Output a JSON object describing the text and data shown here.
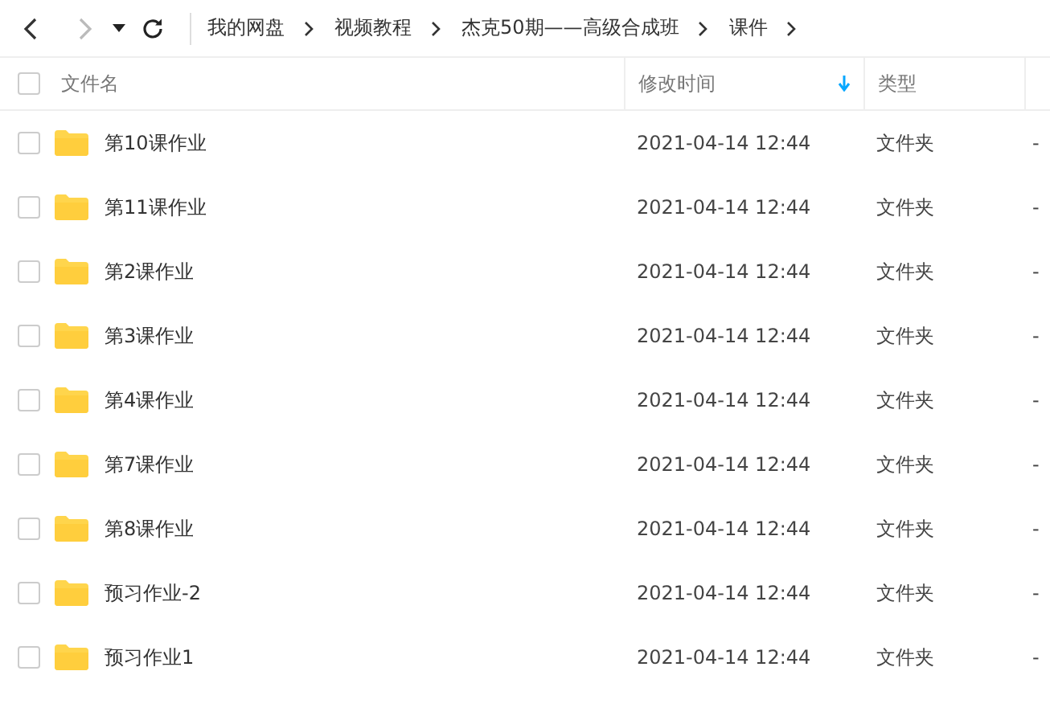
{
  "nav": {
    "back_disabled": false,
    "forward_disabled": true
  },
  "select_all": {
    "checked": false
  },
  "breadcrumb": [
    "我的网盘",
    "视频教程",
    "杰克50期——高级合成班",
    "课件"
  ],
  "table": {
    "columns": [
      {
        "label": "文件名",
        "sorted": false
      },
      {
        "label": "修改时间",
        "sorted": true
      },
      {
        "label": "类型",
        "sorted": false
      }
    ],
    "rows": [
      {
        "name": "第10课作业",
        "modified": "2021-04-14 12:44",
        "type": "文件夹",
        "size": "-",
        "checked": false
      },
      {
        "name": "第11课作业",
        "modified": "2021-04-14 12:44",
        "type": "文件夹",
        "size": "-",
        "checked": false
      },
      {
        "name": "第2课作业",
        "modified": "2021-04-14 12:44",
        "type": "文件夹",
        "size": "-",
        "checked": false
      },
      {
        "name": "第3课作业",
        "modified": "2021-04-14 12:44",
        "type": "文件夹",
        "size": "-",
        "checked": false
      },
      {
        "name": "第4课作业",
        "modified": "2021-04-14 12:44",
        "type": "文件夹",
        "size": "-",
        "checked": false
      },
      {
        "name": "第7课作业",
        "modified": "2021-04-14 12:44",
        "type": "文件夹",
        "size": "-",
        "checked": false
      },
      {
        "name": "第8课作业",
        "modified": "2021-04-14 12:44",
        "type": "文件夹",
        "size": "-",
        "checked": false
      },
      {
        "name": "预习作业-2",
        "modified": "2021-04-14 12:44",
        "type": "文件夹",
        "size": "-",
        "checked": false
      },
      {
        "name": "预习作业1",
        "modified": "2021-04-14 12:44",
        "type": "文件夹",
        "size": "-",
        "checked": false
      }
    ]
  }
}
